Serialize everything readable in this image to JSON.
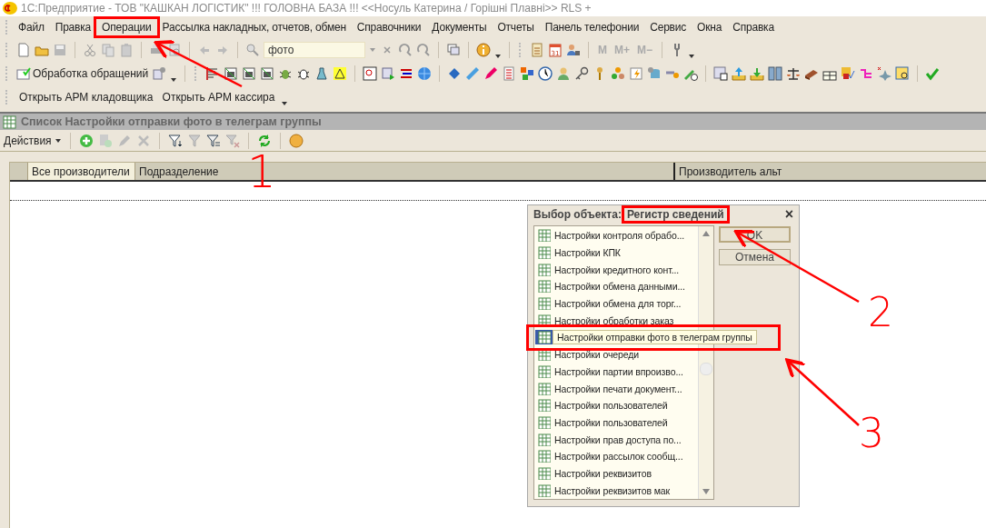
{
  "window": {
    "title": "1С:Предприятие - ТОВ \"КАШКАН ЛОГІСТИК\"  !!! ГОЛОВНА БАЗА !!! <<Носуль Катерина / Горішні Плавні>> RLS +"
  },
  "menu": [
    {
      "label": "Файл",
      "highlighted": false
    },
    {
      "label": "Правка",
      "highlighted": false
    },
    {
      "label": "Операции",
      "highlighted": true
    },
    {
      "label": "Рассылка накладных, отчетов, обмен",
      "highlighted": false
    },
    {
      "label": "Справочники",
      "highlighted": false
    },
    {
      "label": "Документы",
      "highlighted": false
    },
    {
      "label": "Отчеты",
      "highlighted": false
    },
    {
      "label": "Панель телефонии",
      "highlighted": false
    },
    {
      "label": "Сервис",
      "highlighted": false
    },
    {
      "label": "Окна",
      "highlighted": false
    },
    {
      "label": "Справка",
      "highlighted": false
    }
  ],
  "toolbar": {
    "search_value": "фото",
    "memory_buttons": [
      "M",
      "M+",
      "M−"
    ],
    "processing_button": "Обработка обращений",
    "calendar_day": "31"
  },
  "quick_links": [
    "Открыть АРМ кладовщика",
    "Открыть АРМ кассира"
  ],
  "list_window": {
    "title": "Список Настройки отправки фото в телеграм группы",
    "actions_button": "Действия",
    "columns": [
      {
        "label": "Все производители",
        "selected": true
      },
      {
        "label": "Подразделение",
        "selected": false
      },
      {
        "label": "Производитель альт",
        "selected": false
      }
    ]
  },
  "dialog": {
    "title": "Выбор объекта:",
    "subtitle": "Регистр сведений",
    "subtitle_highlighted": true,
    "close": "×",
    "items": [
      {
        "label": "Настройки контроля обрабо...",
        "selected": false,
        "highlighted": false
      },
      {
        "label": "Настройки КПК",
        "selected": false,
        "highlighted": false
      },
      {
        "label": "Настройки кредитного конт...",
        "selected": false,
        "highlighted": false
      },
      {
        "label": "Настройки обмена данными...",
        "selected": false,
        "highlighted": false
      },
      {
        "label": "Настройки обмена для торг...",
        "selected": false,
        "highlighted": false
      },
      {
        "label": "Настройки обработки заказ",
        "selected": false,
        "highlighted": false
      },
      {
        "label": "Настройки отправки фото в телеграм группы",
        "selected": true,
        "highlighted": true
      },
      {
        "label": "Настройки очереди",
        "selected": false,
        "highlighted": false
      },
      {
        "label": "Настройки партии впроизво...",
        "selected": false,
        "highlighted": false
      },
      {
        "label": "Настройки печати документ...",
        "selected": false,
        "highlighted": false
      },
      {
        "label": "Настройки пользователей",
        "selected": false,
        "highlighted": false
      },
      {
        "label": "Настройки пользователей",
        "selected": false,
        "highlighted": false
      },
      {
        "label": "Настройки прав доступа по...",
        "selected": false,
        "highlighted": false
      },
      {
        "label": "Настройки рассылок сообщ...",
        "selected": false,
        "highlighted": false
      },
      {
        "label": "Настройки реквизитов",
        "selected": false,
        "highlighted": false
      },
      {
        "label": "Настройки реквизитов мак",
        "selected": false,
        "highlighted": false
      }
    ],
    "buttons": [
      "OK",
      "Отмена"
    ]
  },
  "annotations": [
    {
      "kind": "number",
      "label": "1"
    },
    {
      "kind": "number",
      "label": "2"
    },
    {
      "kind": "number",
      "label": "3"
    }
  ]
}
